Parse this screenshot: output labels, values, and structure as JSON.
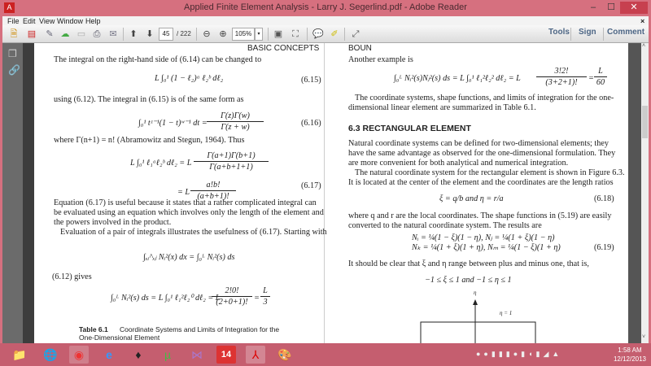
{
  "window": {
    "title": "Applied Finite Element Analysis - Larry J. Segerlind.pdf - Adobe Reader",
    "minimize": "–",
    "maximize": "☐",
    "close": "✕"
  },
  "menu": [
    "File",
    "Edit",
    "View",
    "Window",
    "Help"
  ],
  "toolbar": {
    "page_current": "45",
    "page_total": "/ 222",
    "zoom": "105%",
    "tools": "Tools",
    "sign": "Sign",
    "comment": "Comment"
  },
  "left_page": {
    "header": "BASIC CONCEPTS",
    "p1": "The integral on the right-hand side of (6.14) can be changed to",
    "eq615": "L ∫₀¹ (1 − ℓ₂)ᵃ ℓ₂ᵇ dℓ₂",
    "n615": "(6.15)",
    "p2": "using (6.12). The integral in (6.15) is of the same form as",
    "eq616_l": "∫₀¹ tᶻ⁻¹(1 − t)ʷ⁻¹ dt =",
    "eq616_num": "Γ(z)Γ(w)",
    "eq616_den": "Γ(z + w)",
    "n616": "(6.16)",
    "p3": "where Γ(n+1) = n! (Abramowitz and Stegun, 1964). Thus",
    "eq617a_l": "L ∫₀¹ ℓ₁ᵃℓ₂ᵇ dℓ₂ = L",
    "eq617a_num": "Γ(a+1)Γ(b+1)",
    "eq617a_den": "Γ(a+b+1+1)",
    "eq617b_l": "= L",
    "eq617b_num": "a!b!",
    "eq617b_den": "(a+b+1)!",
    "n617": "(6.17)",
    "p4a": "Equation (6.17) is useful because it states that a rather complicated integral can",
    "p4b": "be evaluated using an equation which involves only the length of the element and",
    "p4c": "the powers involved in the product.",
    "p5": "Evaluation of a pair of integrals illustrates the usefulness of (6.17). Starting with",
    "eq_pair": "∫ₓᵢ^ₓⱼ Nᵢ²(x) dx = ∫₀ᴸ Nᵢ²(s) ds",
    "p6": "(6.12) gives",
    "eq_gives_l": "∫₀ᴸ Nᵢ²(s) ds = L ∫₀¹ ℓ₁²ℓ₂⁰ dℓ₂ = L",
    "eq_gives_num": "2!0!",
    "eq_gives_den": "(2+0+1)!",
    "eq_gives_eq": "=",
    "eq_gives_rnum": "L",
    "eq_gives_rden": "3",
    "table_label": "Table 6.1",
    "table_title": "Coordinate Systems and Limits of Integration for the",
    "table_title2": "One-Dimensional Element"
  },
  "right_page": {
    "header": "BOUN",
    "p1": "Another example is",
    "eq_l": "∫₀ᴸ Nᵢ²(s)Nⱼ²(s) ds = L ∫₀¹ ℓ₁²ℓ₂² dℓ₂ = L",
    "eq_num": "3!2!",
    "eq_den": "(3+2+1)!",
    "eq_eq": "=",
    "eq_rnum": "L",
    "eq_rden": "60",
    "p2a": "The coordinate systems, shape functions, and limits of integration for the one-",
    "p2b": "dimensional linear element are summarized in Table 6.1.",
    "section": "6.3   RECTANGULAR ELEMENT",
    "p3a": "Natural coordinate systems can be defined for two-dimensional elements; they",
    "p3b": "have the same advantage as observed for the one-dimensional formulation. They",
    "p3c": "are more convenient for both analytical and numerical integration.",
    "p4a": "The natural coordinate system for the rectangular element is shown in Figure 6.3.",
    "p4b": "It is located at the center of the element and the coordinates are the length ratios",
    "eq618": "ξ = q/b        and        η = r/a",
    "n618": "(6.18)",
    "p5a": "where q and r are the local coordinates. The shape functions in (5.19) are easily",
    "p5b": "converted to the natural coordinate system. The results are",
    "eq619a": "Nᵢ = ¼(1 − ξ)(1 − η),        Nⱼ = ¼(1 + ξ)(1 − η)",
    "eq619b": "Nₖ = ¼(1 + ξ)(1 + η),        Nₘ = ¼(1 − ξ)(1 + η)",
    "n619": "(6.19)",
    "p6": "It should be clear that ξ and η range between plus and minus one, that is,",
    "eq_range": "−1 ≤ ξ ≤ 1        and        −1 ≤ η ≤ 1",
    "fig_eta": "η",
    "fig_eta1": "η = 1"
  },
  "taskbar": {
    "time": "1:58 AM",
    "date": "12/12/2013",
    "apps": [
      "file-explorer",
      "network",
      "chrome",
      "internet-explorer",
      "inkscape",
      "utorrent",
      "visual-studio",
      "fourteen-app",
      "adobe-reader",
      "paint"
    ]
  }
}
